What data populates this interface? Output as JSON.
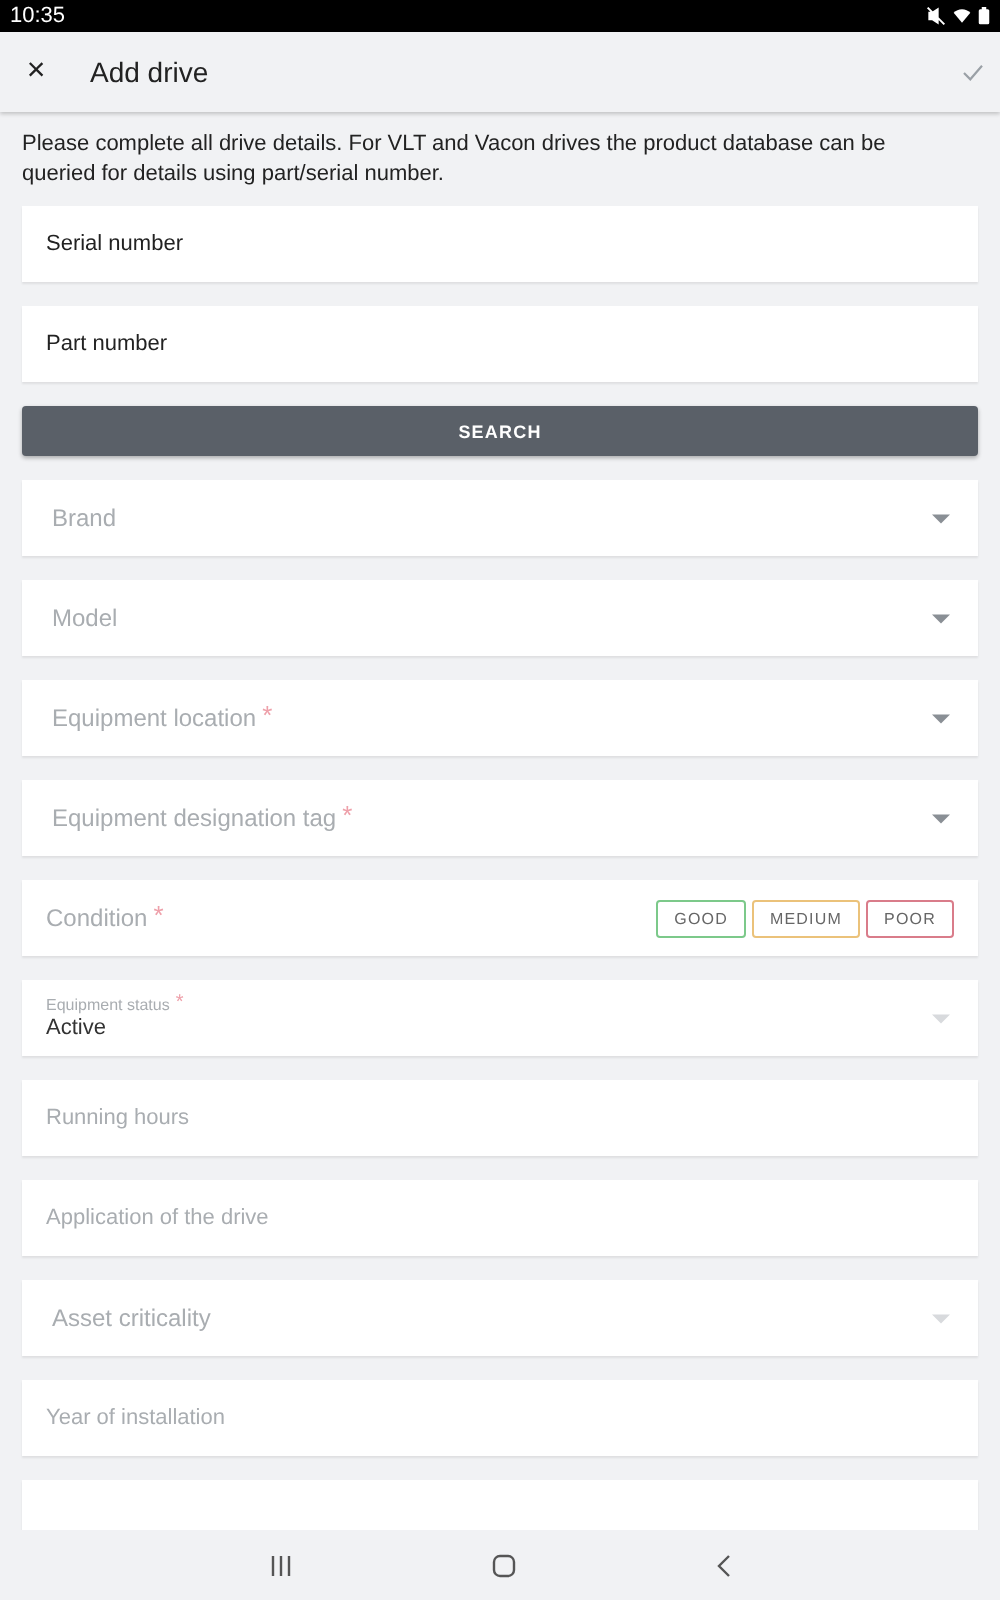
{
  "status_bar": {
    "time": "10:35"
  },
  "app_bar": {
    "close": "×",
    "title": "Add drive"
  },
  "intro": "Please complete all drive details. For VLT and Vacon drives the product database can be queried for details using part/serial number.",
  "lookup_fields": [
    {
      "kind": "text",
      "value": "Serial number"
    },
    {
      "kind": "text",
      "value": "Part number"
    }
  ],
  "search_button": "SEARCH",
  "fields": [
    {
      "kind": "dropdown",
      "placeholder": "Brand"
    },
    {
      "kind": "dropdown",
      "placeholder": "Model"
    },
    {
      "kind": "dropdown",
      "placeholder": "Equipment location",
      "required_mark": "*"
    },
    {
      "kind": "dropdown",
      "placeholder": "Equipment designation tag",
      "required_mark": "*"
    },
    {
      "kind": "chips",
      "placeholder": "Condition",
      "required_mark": "*",
      "options": [
        {
          "label": "GOOD",
          "color": "#7cc98a",
          "selected": false
        },
        {
          "label": "MEDIUM",
          "color": "#ebc27a",
          "selected": false
        },
        {
          "label": "POOR",
          "color": "#d97c8a",
          "selected": false
        }
      ]
    },
    {
      "kind": "select",
      "label": "Equipment status",
      "required_mark": "*",
      "value": "Active"
    },
    {
      "kind": "text",
      "placeholder": "Running hours"
    },
    {
      "kind": "text",
      "placeholder": "Application of the drive"
    },
    {
      "kind": "dropdown",
      "placeholder": "Asset criticality",
      "disabled": true
    },
    {
      "kind": "text",
      "placeholder": "Year of installation"
    },
    {
      "kind": "partial"
    }
  ]
}
